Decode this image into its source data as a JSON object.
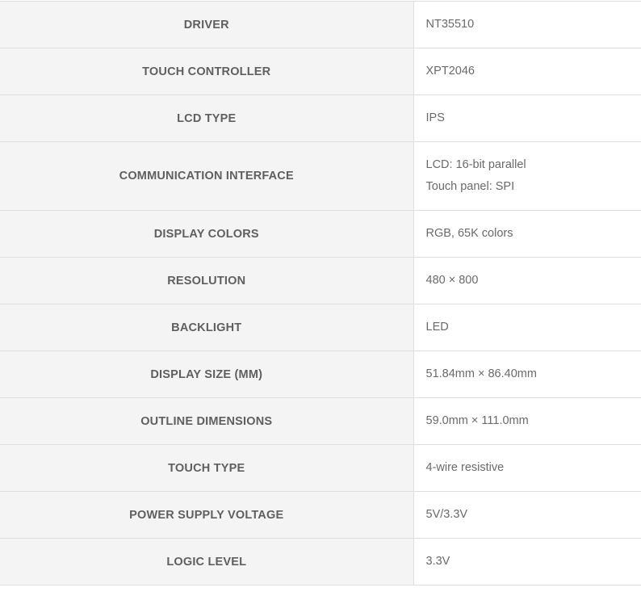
{
  "specs": [
    {
      "label": "DRIVER",
      "values": [
        "NT35510"
      ]
    },
    {
      "label": "TOUCH CONTROLLER",
      "values": [
        "XPT2046"
      ]
    },
    {
      "label": "LCD TYPE",
      "values": [
        "IPS"
      ]
    },
    {
      "label": "COMMUNICATION INTERFACE",
      "values": [
        "LCD: 16-bit parallel",
        "Touch panel: SPI"
      ]
    },
    {
      "label": "DISPLAY COLORS",
      "values": [
        "RGB, 65K colors"
      ]
    },
    {
      "label": "RESOLUTION",
      "values": [
        "480 × 800"
      ]
    },
    {
      "label": "BACKLIGHT",
      "values": [
        "LED"
      ]
    },
    {
      "label": "DISPLAY SIZE (MM)",
      "values": [
        "51.84mm × 86.40mm"
      ]
    },
    {
      "label": "OUTLINE DIMENSIONS",
      "values": [
        "59.0mm × 111.0mm"
      ]
    },
    {
      "label": "TOUCH TYPE",
      "values": [
        "4-wire resistive"
      ]
    },
    {
      "label": "POWER SUPPLY VOLTAGE",
      "values": [
        "5V/3.3V"
      ]
    },
    {
      "label": "LOGIC LEVEL",
      "values": [
        "3.3V"
      ]
    }
  ]
}
